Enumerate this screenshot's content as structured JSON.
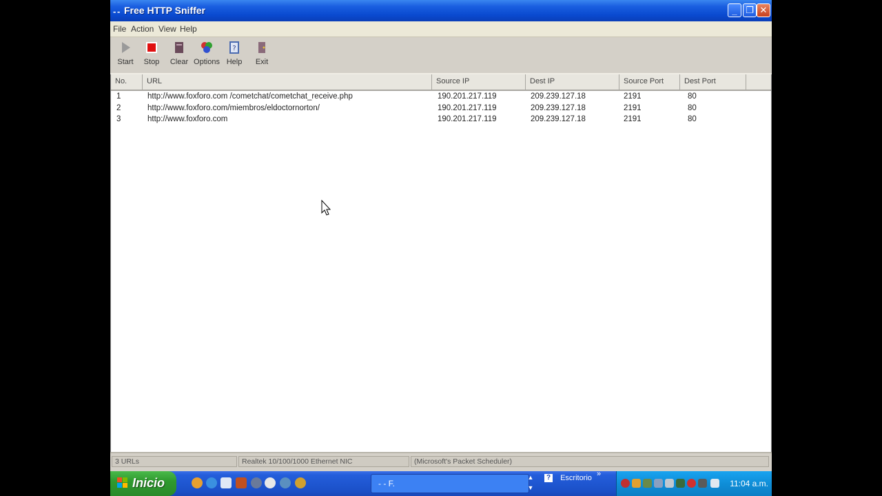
{
  "window": {
    "title": "Free HTTP Sniffer",
    "app_icon": "- -"
  },
  "menu": [
    "File",
    "Action",
    "View",
    "Help"
  ],
  "toolbar": [
    {
      "label": "Start",
      "icon": "play-icon"
    },
    {
      "label": "Stop",
      "icon": "stop-icon"
    },
    {
      "label": "Clear",
      "icon": "clear-icon"
    },
    {
      "label": "Options",
      "icon": "options-icon"
    },
    {
      "label": "Help",
      "icon": "help-icon"
    },
    {
      "label": "Exit",
      "icon": "exit-icon"
    }
  ],
  "columns": [
    "No.",
    "URL",
    "Source IP",
    "Dest IP",
    "Source Port",
    "Dest Port"
  ],
  "rows": [
    {
      "no": "1",
      "url": "http://www.foxforo.com /cometchat/cometchat_receive.php",
      "src_ip": "190.201.217.119",
      "dst_ip": "209.239.127.18",
      "src_port": "2191",
      "dst_port": "80"
    },
    {
      "no": "2",
      "url": "http://www.foxforo.com/miembros/eldoctornorton/",
      "src_ip": "190.201.217.119",
      "dst_ip": "209.239.127.18",
      "src_port": "2191",
      "dst_port": "80"
    },
    {
      "no": "3",
      "url": "http://www.foxforo.com",
      "src_ip": "190.201.217.119",
      "dst_ip": "209.239.127.18",
      "src_port": "2191",
      "dst_port": "80"
    }
  ],
  "status": {
    "count": "3 URLs",
    "adapter": "Realtek 10/100/1000 Ethernet NIC",
    "scheduler": "(Microsoft's Packet Scheduler)"
  },
  "taskbar": {
    "start_label": "Inicio",
    "task_label": "- -  F.",
    "desktop_label": "Escritorio",
    "chevron": "»",
    "clock": "11:04 a.m."
  },
  "colors": {
    "titlebar": "#0a4ad0",
    "taskbar": "#245edb",
    "start": "#2f9a2f",
    "tray": "#0f8ed8"
  }
}
